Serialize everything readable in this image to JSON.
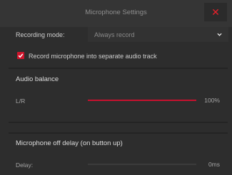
{
  "window": {
    "title": "Microphone Settings",
    "close_icon": "close-icon",
    "accent_color": "#d0152c"
  },
  "recording": {
    "mode_label": "Recording mode:",
    "mode_value": "Always record",
    "separate_track_checked": true,
    "separate_track_label": "Record microphone into separate audio track"
  },
  "audio_balance": {
    "section_title": "Audio balance",
    "slider_label": "L/R",
    "value_text": "100%",
    "fraction": 1.0
  },
  "mic_off_delay": {
    "section_title": "Microphone off delay (on button up)",
    "slider_label": "Delay:",
    "value_text": "0ms",
    "fraction": 0.0
  }
}
